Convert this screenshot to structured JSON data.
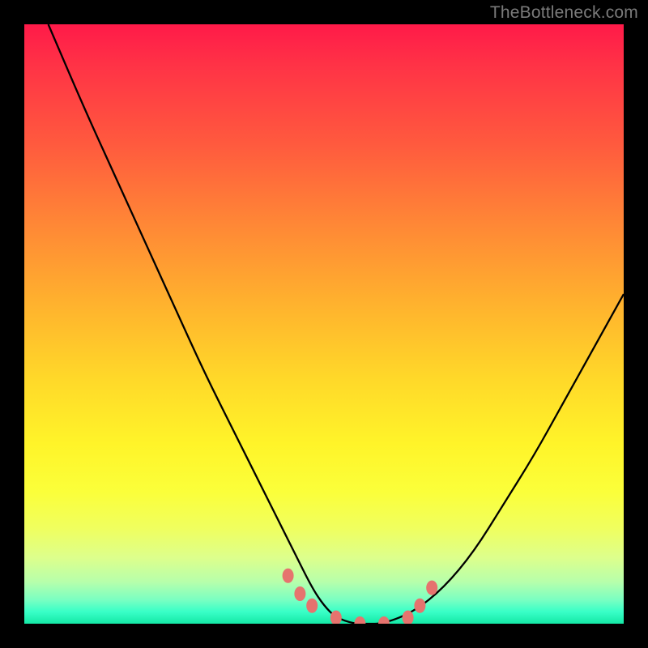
{
  "watermark": {
    "text": "TheBottleneck.com"
  },
  "chart_data": {
    "type": "line",
    "title": "",
    "xlabel": "",
    "ylabel": "",
    "xlim": [
      0,
      100
    ],
    "ylim": [
      0,
      100
    ],
    "series": [
      {
        "name": "bottleneck-curve",
        "x": [
          4,
          10,
          15,
          20,
          25,
          30,
          35,
          40,
          45,
          48,
          50,
          52,
          55,
          57,
          60,
          65,
          70,
          75,
          80,
          85,
          90,
          95,
          100
        ],
        "y": [
          100,
          86,
          75,
          64,
          53,
          42,
          32,
          22,
          12,
          6,
          3,
          1,
          0,
          0,
          0,
          2,
          6,
          12,
          20,
          28,
          37,
          46,
          55
        ]
      }
    ],
    "markers": {
      "name": "dotted-region",
      "x": [
        44,
        46,
        48,
        52,
        56,
        60,
        64,
        66,
        68
      ],
      "y": [
        8,
        5,
        3,
        1,
        0,
        0,
        1,
        3,
        6
      ],
      "color": "#e6736e"
    },
    "gradient_stops": [
      {
        "pos": 0,
        "color": "#ff1a49"
      },
      {
        "pos": 50,
        "color": "#ffc82c"
      },
      {
        "pos": 80,
        "color": "#fbff3a"
      },
      {
        "pos": 100,
        "color": "#14e8a6"
      }
    ]
  }
}
